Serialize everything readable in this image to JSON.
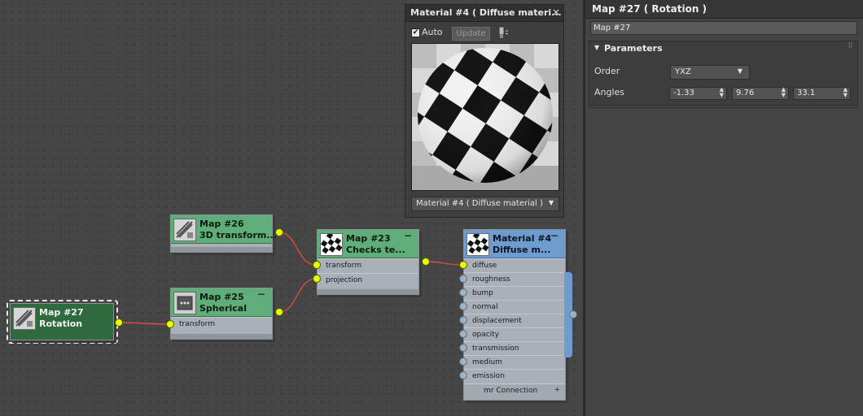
{
  "preview_window": {
    "title": "Material #4  ( Diffuse materi...",
    "close": "×",
    "auto_label": "Auto",
    "auto_checked": true,
    "auto_check_glyph": "✔",
    "update_label": "Update",
    "material_select": "Material #4  ( Diffuse material )"
  },
  "nodes": {
    "map26": {
      "line1": "Map #26",
      "line2": "3D transform..."
    },
    "map25": {
      "line1": "Map #25",
      "line2": "Spherical",
      "collapse": "−",
      "slots": [
        "transform"
      ]
    },
    "map27": {
      "line1": "Map #27",
      "line2": "Rotation"
    },
    "map23": {
      "line1": "Map #23",
      "line2": "Checks te...",
      "collapse": "−",
      "slots": [
        "transform",
        "projection"
      ]
    },
    "material4": {
      "line1": "Material #4",
      "line2": "Diffuse  m...",
      "collapse": "−",
      "slots": [
        "diffuse",
        "roughness",
        "bump",
        "normal",
        "displacement",
        "opacity",
        "transmission",
        "medium",
        "emission"
      ],
      "footer": "mr Connection",
      "footer_icon": "+"
    }
  },
  "panel": {
    "title": "Map #27  ( Rotation )",
    "name_value": "Map #27",
    "rollout_title": "Parameters",
    "order_label": "Order",
    "order_value": "YXZ",
    "angles_label": "Angles",
    "angles": [
      "-1.33",
      "9.76",
      "33.1"
    ]
  },
  "colors": {
    "canvas_bg": "#464646",
    "node_header_green": "#5fae7a",
    "node_header_blue": "#6e9ccf",
    "node_selected": "#2f6a3f",
    "port_yellow": "#e8ff00",
    "wire_red": "#e0483a"
  },
  "icons": {
    "collapse": "minus-icon",
    "close": "close-icon",
    "dropdown": "chevron-down-icon",
    "spinner": "spinner-arrows-icon"
  }
}
